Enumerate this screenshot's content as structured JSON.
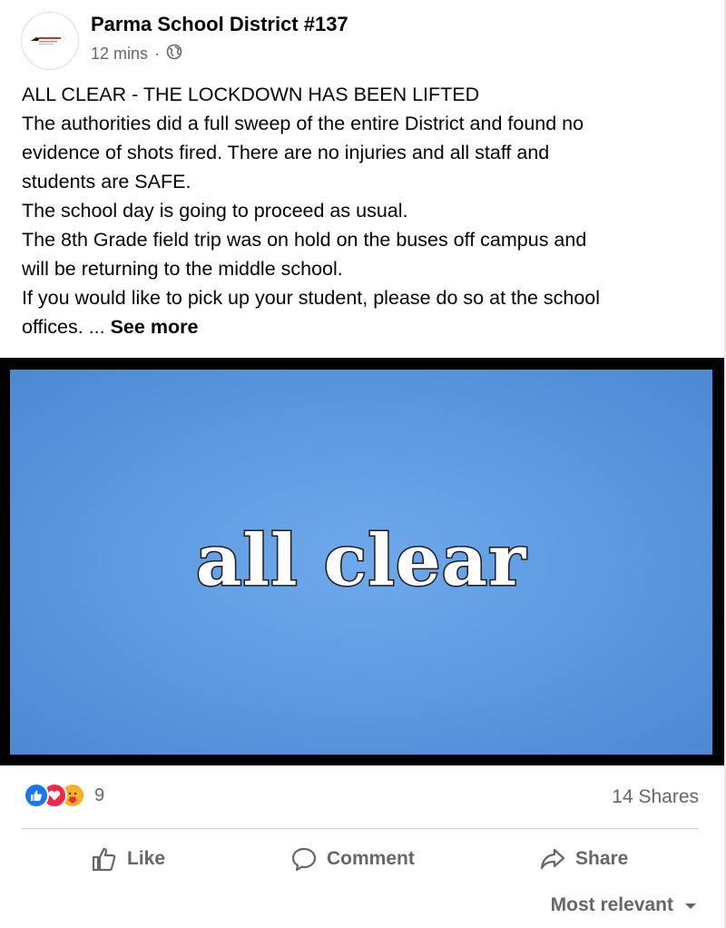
{
  "post": {
    "page_name": "Parma School District #137",
    "time": "12 mins",
    "separator": "·",
    "privacy_icon": "globe-icon",
    "text_lines": [
      "ALL CLEAR - THE LOCKDOWN HAS BEEN LIFTED",
      "The authorities did a full sweep of the entire District and found no",
      "evidence of shots fired. There are no injuries and all staff and",
      "students are SAFE.",
      "The school day is going to proceed as usual.",
      "The 8th Grade field trip was on hold on the buses off campus and",
      "will be returning to the middle school.",
      "If you would like to pick up your student, please do so at the school"
    ],
    "last_line_text": "offices. ... ",
    "see_more": "See more",
    "image_text": "all clear"
  },
  "engagement": {
    "reaction_icons": [
      "like-icon",
      "love-icon",
      "care-icon"
    ],
    "reaction_count": "9",
    "shares": "14 Shares"
  },
  "actions": {
    "like": "Like",
    "comment": "Comment",
    "share": "Share"
  },
  "comments": {
    "sort_label": "Most relevant"
  },
  "colors": {
    "like_blue": "#1877f2",
    "love_red": "#f02849",
    "care_yellow": "#f7b125",
    "secondary_text": "#65676b",
    "image_blue": "#5b98e0"
  }
}
